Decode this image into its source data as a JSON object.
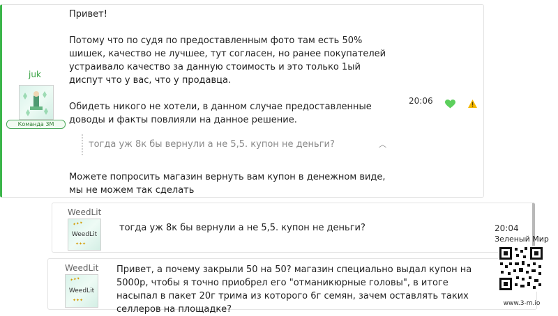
{
  "messages": [
    {
      "author": "juk",
      "role_badge": "Команда 3М",
      "time": "20:06",
      "text1": "Привет!\n\nПотому что по судя по предоставленным фото там есть 50% шишек, качество не лучшее, тут согласен, но ранее покупателей устраивало качество за данную стоимость и это только 1ый диспут что у вас, что у продавца.\n\nОбидеть никого не хотели, в данном случае предоставленные доводы и факты повлияли на данное решение.",
      "quote": "тогда уж 8к бы вернули а не 5,5. купон не деньги?",
      "text2": "Можете попросить магазин вернуть вам купон в денежном виде, мы не можем так сделать"
    },
    {
      "author": "WeedLit",
      "avatar_text": "WeedLit",
      "time": "20:04",
      "text": "тогда уж 8к бы вернули а не 5,5. купон не деньги?"
    },
    {
      "author": "WeedLit",
      "avatar_text": "WeedLit",
      "text": "Привет, а почему закрыли 50 на 50? магазин специально выдал купон на 5000р, чтобы я точно приобрел его \"отманикюрные головы\", в итоге насыпал в пакет 20г трима из которого 6г семян, зачем оставлять таких селлеров на площадке?"
    }
  ],
  "watermark": {
    "title": "Зеленый Мир",
    "url": "www.3-m.io"
  },
  "colors": {
    "accent_green": "#3bb54a",
    "like_heart": "#5ccf5c",
    "warning": "#f5b800"
  },
  "icons": [
    "heart-icon",
    "warning-icon",
    "chevron-up-icon",
    "qr-code-icon"
  ]
}
